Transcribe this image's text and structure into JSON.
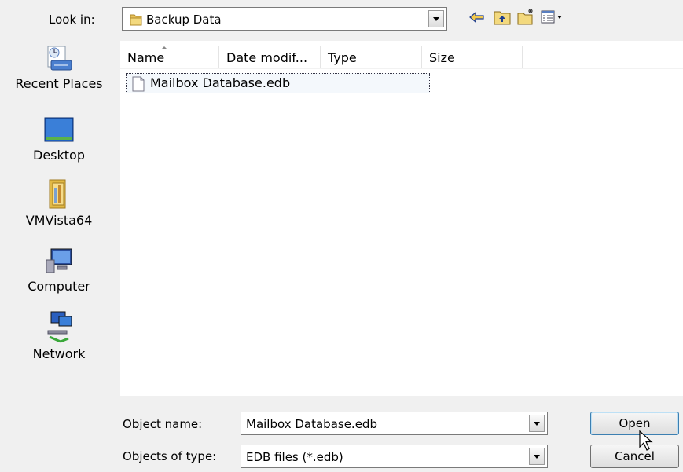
{
  "lookin": {
    "label": "Look in:",
    "value": "Backup Data"
  },
  "toolbar": {
    "back_icon": "back-arrow-icon",
    "up_icon": "up-folder-icon",
    "newfolder_icon": "new-folder-icon",
    "views_icon": "view-menu-icon"
  },
  "places": [
    {
      "label": "Recent Places",
      "icon": "recent-places-icon"
    },
    {
      "label": "Desktop",
      "icon": "desktop-icon"
    },
    {
      "label": "VMVista64",
      "icon": "user-folder-icon"
    },
    {
      "label": "Computer",
      "icon": "computer-icon"
    },
    {
      "label": "Network",
      "icon": "network-icon"
    }
  ],
  "columns": [
    "Name",
    "Date modif...",
    "Type",
    "Size"
  ],
  "files": [
    {
      "name": "Mailbox Database.edb"
    }
  ],
  "object_name": {
    "label": "Object name:",
    "value": "Mailbox Database.edb"
  },
  "object_type": {
    "label": "Objects of type:",
    "value": "EDB files (*.edb)"
  },
  "buttons": {
    "open": "Open",
    "cancel": "Cancel"
  },
  "colors": {
    "accent": "#3c7fb1",
    "selection": "#f4f8fc",
    "background": "#f0f0f0"
  }
}
